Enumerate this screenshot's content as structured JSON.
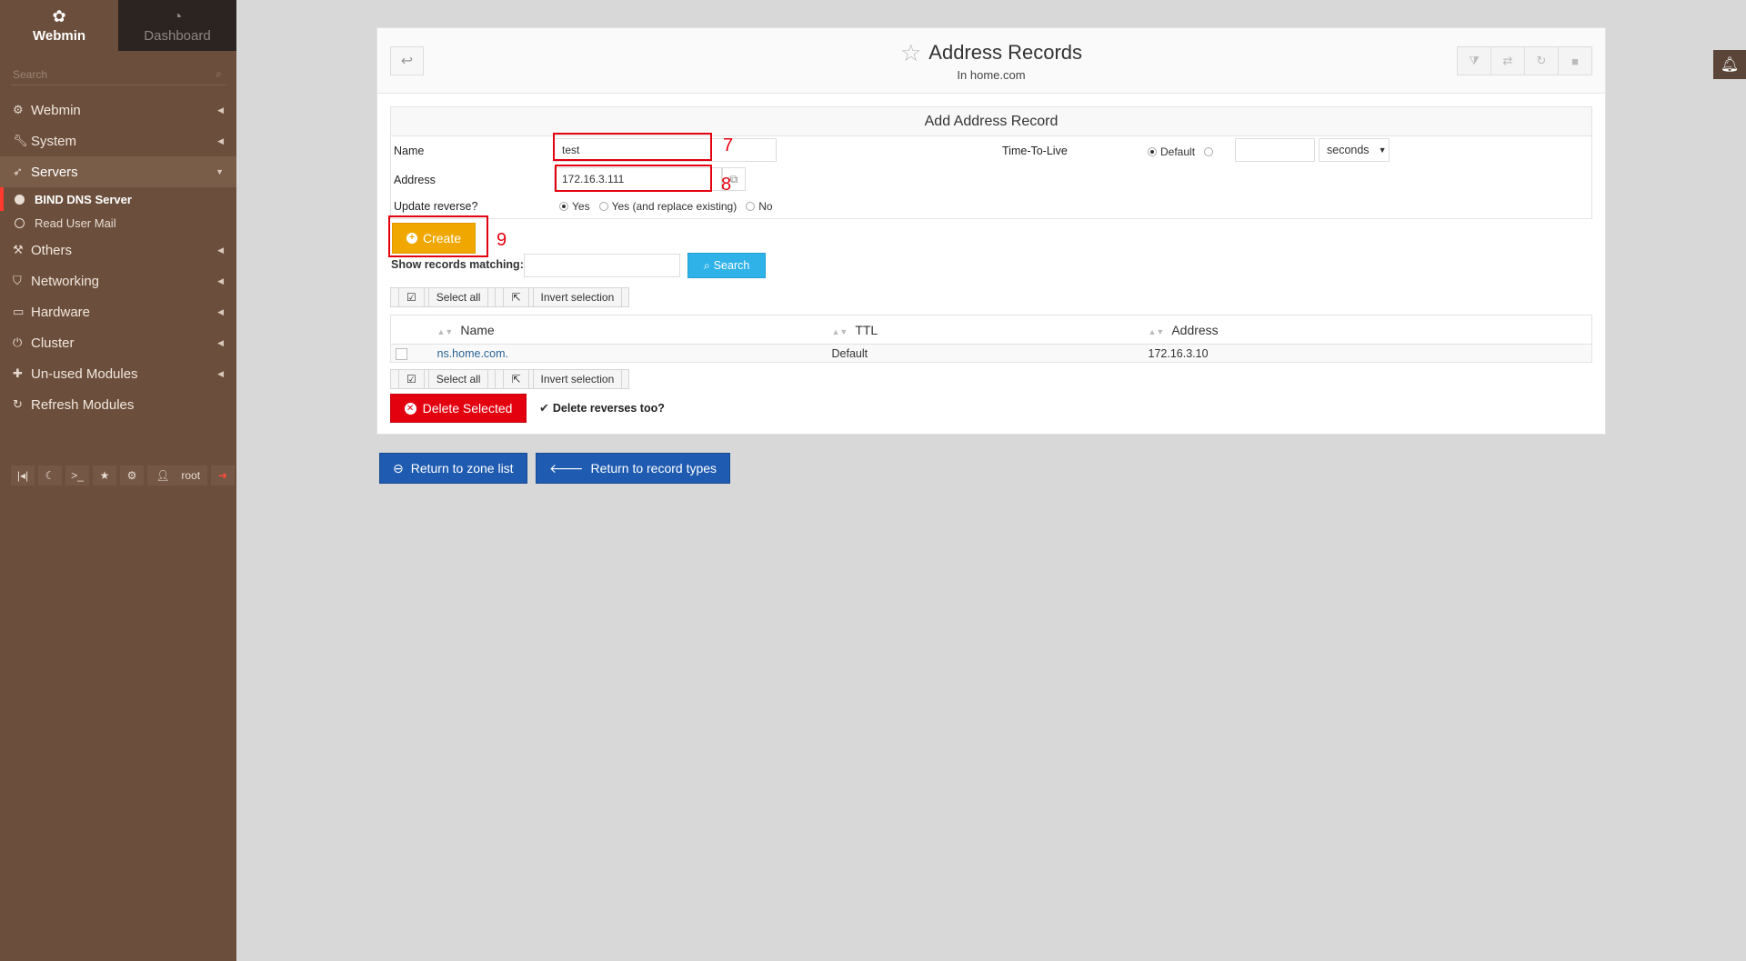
{
  "sidebar": {
    "tabs": [
      {
        "label": "Webmin",
        "icon": "webmin-logo-icon"
      },
      {
        "label": "Dashboard",
        "icon": "dashboard-gauge-icon"
      }
    ],
    "search_placeholder": "Search",
    "items": [
      {
        "label": "Webmin",
        "icon": "gear-icon"
      },
      {
        "label": "System",
        "icon": "wrench-icon"
      },
      {
        "label": "Servers",
        "icon": "rocket-icon"
      },
      {
        "label": "BIND DNS Server"
      },
      {
        "label": "Read User Mail"
      },
      {
        "label": "Others",
        "icon": "hammer-icon"
      },
      {
        "label": "Networking",
        "icon": "shield-icon"
      },
      {
        "label": "Hardware",
        "icon": "hdd-icon"
      },
      {
        "label": "Cluster",
        "icon": "power-icon"
      },
      {
        "label": "Un-used Modules",
        "icon": "puzzle-icon"
      },
      {
        "label": "Refresh Modules",
        "icon": "refresh-icon"
      }
    ],
    "toolbar_user": "root"
  },
  "header": {
    "title": "Address Records",
    "subtitle": "In home.com"
  },
  "form": {
    "title": "Add Address Record",
    "name_label": "Name",
    "name_value": "test",
    "address_label": "Address",
    "address_value": "172.16.3.111",
    "ttl_label": "Time-To-Live",
    "ttl_default": "Default",
    "ttl_unit": "seconds",
    "reverse_label": "Update reverse?",
    "reverse_options": [
      "Yes",
      "Yes (and replace existing)",
      "No"
    ],
    "reverse_selected": "Yes",
    "create_label": "Create"
  },
  "annotations": [
    "7",
    "8",
    "9"
  ],
  "search": {
    "label": "Show records matching:",
    "button": "Search"
  },
  "selection": {
    "select_all": "Select all",
    "invert": "Invert selection"
  },
  "table": {
    "columns": [
      "Name",
      "TTL",
      "Address"
    ],
    "rows": [
      {
        "name": "ns.home.com.",
        "ttl": "Default",
        "address": "172.16.3.10"
      }
    ]
  },
  "delete": {
    "button": "Delete Selected",
    "reverses_label": "Delete reverses too?",
    "reverses_checked": true
  },
  "footer_buttons": {
    "zone_list": "Return to zone list",
    "record_types": "Return to record types"
  },
  "colors": {
    "sidebar": "#6b4f3c",
    "create": "#f0a800",
    "search": "#2fb2e8",
    "delete": "#e3000f",
    "nav": "#1f5bb0",
    "annotation": "#e3000f"
  }
}
